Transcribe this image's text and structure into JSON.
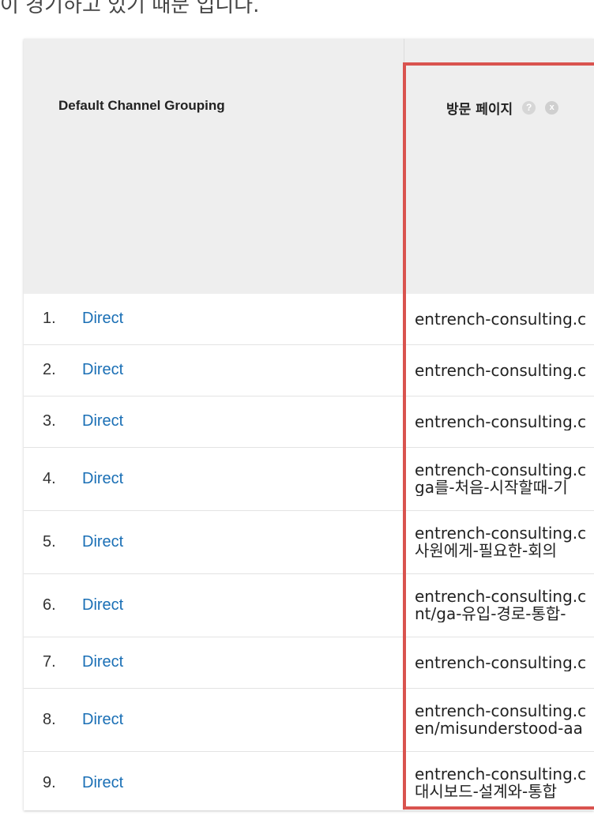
{
  "caption": "이 경기하고 있기 때문 입니다.",
  "table": {
    "col_channel": "Default Channel Grouping",
    "col_page": "방문 페이지",
    "help_icon": "?",
    "remove_icon": "x",
    "rows": [
      {
        "num": "1.",
        "channel": "Direct",
        "page": [
          "entrench-consulting.c"
        ]
      },
      {
        "num": "2.",
        "channel": "Direct",
        "page": [
          "entrench-consulting.c"
        ]
      },
      {
        "num": "3.",
        "channel": "Direct",
        "page": [
          "entrench-consulting.c"
        ]
      },
      {
        "num": "4.",
        "channel": "Direct",
        "page": [
          "entrench-consulting.c",
          "ga를-처음-시작할때-기"
        ]
      },
      {
        "num": "5.",
        "channel": "Direct",
        "page": [
          "entrench-consulting.c",
          "사원에게-필요한-회의"
        ]
      },
      {
        "num": "6.",
        "channel": "Direct",
        "page": [
          "entrench-consulting.c",
          "nt/ga-유입-경로-통합-"
        ]
      },
      {
        "num": "7.",
        "channel": "Direct",
        "page": [
          "entrench-consulting.c"
        ]
      },
      {
        "num": "8.",
        "channel": "Direct",
        "page": [
          "entrench-consulting.c",
          "en/misunderstood-aa"
        ]
      },
      {
        "num": "9.",
        "channel": "Direct",
        "page": [
          "entrench-consulting.c",
          "대시보드-설계와-통합"
        ]
      }
    ]
  },
  "colors": {
    "link": "#1a6fb5",
    "highlight": "#d9534f",
    "header_bg": "#eeeeee"
  }
}
